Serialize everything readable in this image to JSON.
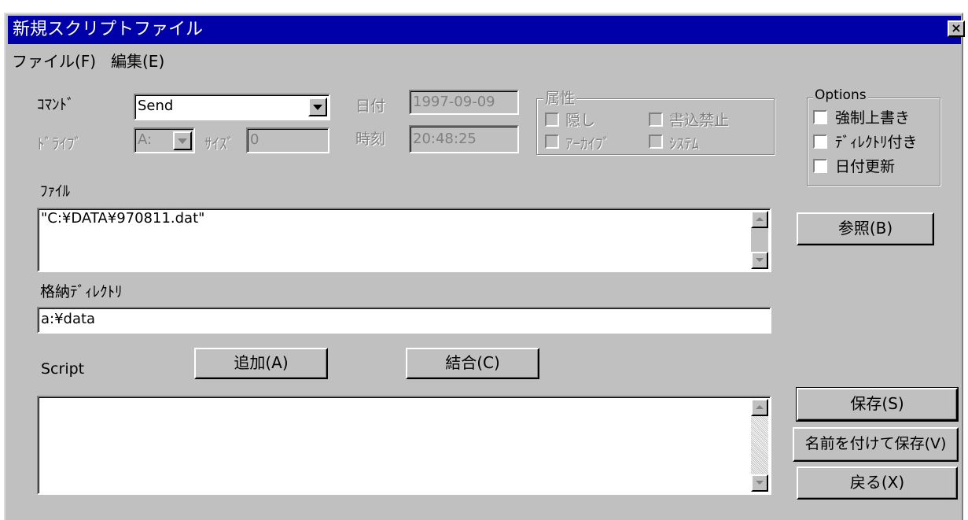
{
  "window": {
    "title": "新規スクリプトファイル",
    "close_label": "×"
  },
  "menu": {
    "file": "ファイル(F)",
    "edit": "編集(E)"
  },
  "command": {
    "label": "ｺﾏﾝﾄﾞ",
    "value": "Send"
  },
  "drive": {
    "label": "ﾄﾞﾗｲﾌﾞ",
    "value": "A:"
  },
  "size": {
    "label": "ｻｲｽﾞ",
    "value": "0"
  },
  "date": {
    "label": "日付",
    "value": "1997-09-09"
  },
  "time": {
    "label": "時刻",
    "value": "20:48:25"
  },
  "attributes": {
    "label": "属性",
    "hidden": "隠し",
    "readonly": "書込禁止",
    "archive": "ｱｰｶｲﾌﾞ",
    "system": "ｼｽﾃﾑ"
  },
  "options": {
    "label": "Options",
    "overwrite": "強制上書き",
    "with_dir": "ﾃﾞｨﾚｸﾄﾘ付き",
    "update_date": "日付更新"
  },
  "file": {
    "label": "ﾌｧｲﾙ",
    "value": "\"C:¥DATA¥970811.dat\""
  },
  "browse_button": "参照(B)",
  "dest_dir": {
    "label": "格納ﾃﾞｨﾚｸﾄﾘ",
    "value": "a:¥data"
  },
  "script": {
    "label": "Script",
    "value": ""
  },
  "add_button": "追加(A)",
  "join_button": "結合(C)",
  "save_button": "保存(S)",
  "save_as_button": "名前を付けて保存(V)",
  "back_button": "戻る(X)"
}
